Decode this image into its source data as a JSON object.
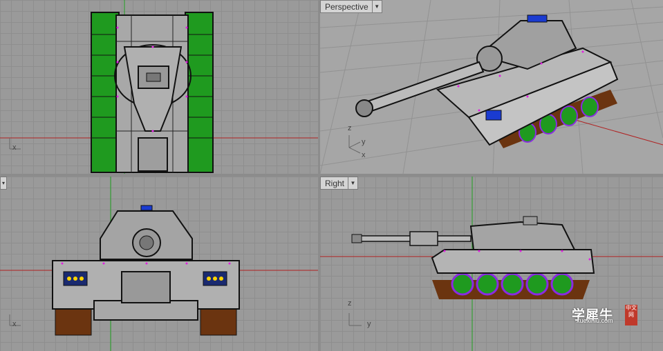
{
  "viewports": {
    "top_left": {
      "label": "",
      "axis_x": "x"
    },
    "top_right": {
      "label": "Perspective",
      "axis_z": "z",
      "axis_y": "y",
      "axis_x": "x"
    },
    "bottom_left": {
      "label": "",
      "axis_x": "x"
    },
    "bottom_right": {
      "label": "Right",
      "axis_z": "z",
      "axis_y": "y"
    }
  },
  "watermark": {
    "brand": "学犀牛",
    "url": "xuexiniu.com",
    "tag": "中文网"
  },
  "colors": {
    "track_green": "#1f9a1f",
    "wheel_purple": "#8a2be2",
    "point_magenta": "#e020e0",
    "x_axis": "#b02020",
    "y_axis": "#20a020",
    "dirt": "#6b3410",
    "light_yellow": "#ffd400",
    "light_blue": "#1a3bd0"
  },
  "icons": {
    "dropdown": "chevron-down-icon",
    "axis_widget": "axis-triad-icon"
  }
}
